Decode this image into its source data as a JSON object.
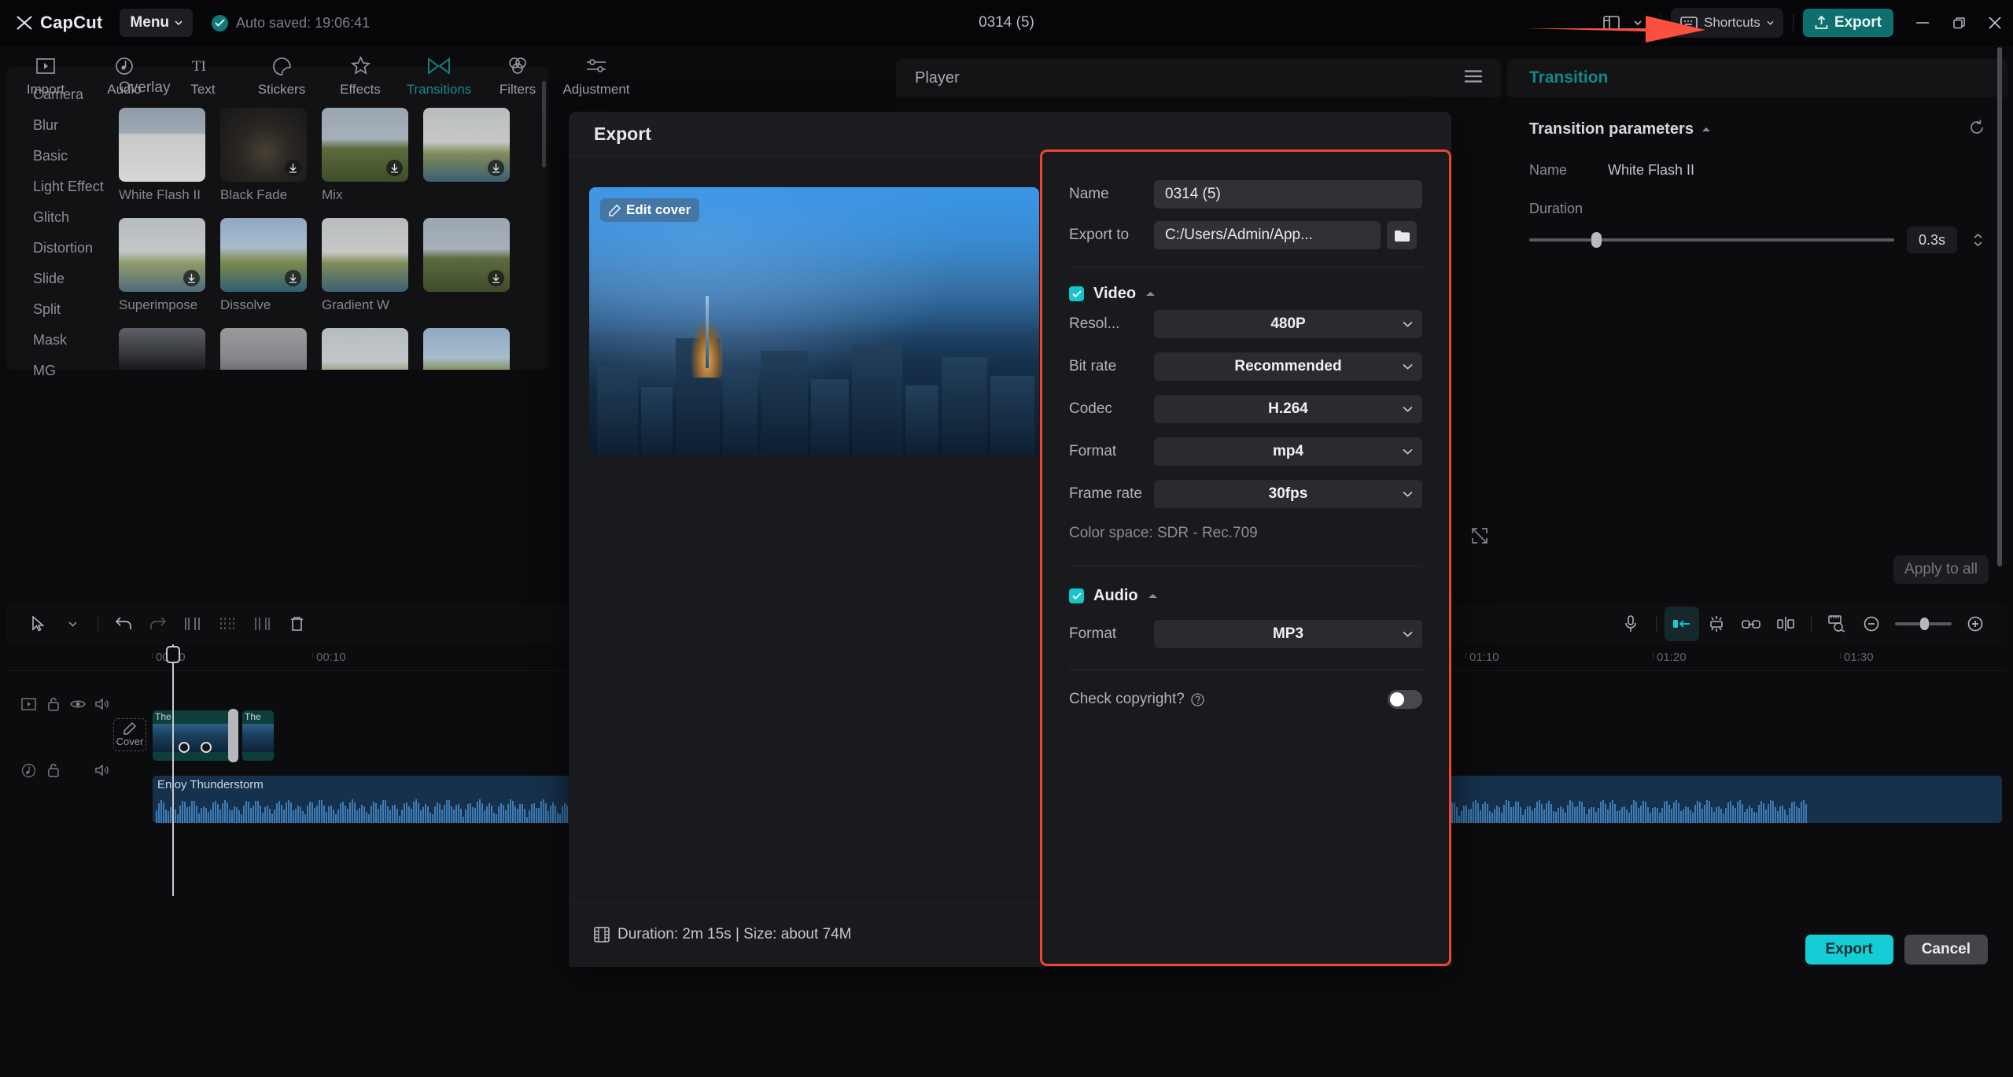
{
  "app": {
    "brand": "CapCut",
    "menu_label": "Menu",
    "autosave_text": "Auto saved: 19:06:41",
    "project_title": "0314 (5)",
    "shortcuts_label": "Shortcuts",
    "export_label": "Export",
    "accent_teal": "#16898a",
    "accent_cyan": "#15cdd4",
    "highlight_red": "#f04432"
  },
  "tabs": [
    {
      "label": "Import",
      "icon": "import-icon",
      "active": false
    },
    {
      "label": "Audio",
      "icon": "audio-icon",
      "active": false
    },
    {
      "label": "Text",
      "icon": "text-icon",
      "active": false
    },
    {
      "label": "Stickers",
      "icon": "stickers-icon",
      "active": false
    },
    {
      "label": "Effects",
      "icon": "effects-icon",
      "active": false
    },
    {
      "label": "Transitions",
      "icon": "transitions-icon",
      "active": true
    },
    {
      "label": "Filters",
      "icon": "filters-icon",
      "active": false
    },
    {
      "label": "Adjustment",
      "icon": "adjustment-icon",
      "active": false
    }
  ],
  "categories": [
    "Camera",
    "Blur",
    "Basic",
    "Light Effect",
    "Glitch",
    "Distortion",
    "Slide",
    "Split",
    "Mask",
    "MG"
  ],
  "transitions": {
    "group_title": "Overlay",
    "items": [
      {
        "name": "White Flash II",
        "art": "art-wf",
        "download": false
      },
      {
        "name": "Black Fade",
        "art": "art-bf",
        "download": true
      },
      {
        "name": "Mix",
        "art": "art-mix",
        "download": true
      },
      {
        "name": "",
        "art": "art-gw",
        "download": true
      },
      {
        "name": "Superimpose",
        "art": "art-sup",
        "download": true
      },
      {
        "name": "Dissolve",
        "art": "art-dis",
        "download": true
      },
      {
        "name": "Gradient W",
        "art": "art-gw",
        "download": false
      },
      {
        "name": "",
        "art": "art-mix",
        "download": true
      },
      {
        "name": "",
        "art": "art-r3a",
        "download": true
      },
      {
        "name": "",
        "art": "art-r3b",
        "download": false
      },
      {
        "name": "",
        "art": "art-sup",
        "download": false
      },
      {
        "name": "",
        "art": "art-dis",
        "download": false
      }
    ]
  },
  "player": {
    "title": "Player",
    "menu_icon": "hamburger-icon",
    "expand_icon": "expand-icon"
  },
  "right_panel": {
    "title": "Transition",
    "section_title": "Transition parameters",
    "reset_icon": "reset-icon",
    "name_label": "Name",
    "name_value": "White Flash II",
    "duration_label": "Duration",
    "duration_value": "0.3s",
    "duration_slider_pct": 17,
    "apply_all_label": "Apply to all"
  },
  "timeline": {
    "tool_icons": [
      "select-arrow-icon",
      "chevron-down-icon",
      "undo-icon",
      "redo-icon",
      "split-left-icon",
      "split-icon",
      "split-right-icon",
      "delete-icon"
    ],
    "right_icons": [
      "mic-icon",
      "auto-fit-icon",
      "snap-icon",
      "link-icon",
      "keyframe-icon",
      "ruler-icon",
      "zoom-out-icon",
      "zoom-in-icon"
    ],
    "ruler_labels": [
      "00:00",
      "00:10",
      "01:10",
      "01:20",
      "01:30"
    ],
    "video_track_icons": [
      "video-icon",
      "lock-icon",
      "eye-icon",
      "speaker-icon"
    ],
    "audio_track_icons": [
      "audio-note-icon",
      "lock-icon",
      "speaker-icon"
    ],
    "cover_label": "Cover",
    "video_clip_label": "The",
    "video_clip_label_2": "The",
    "audio_clip_label": "Enjoy Thunderstorm"
  },
  "export_dialog": {
    "title": "Export",
    "edit_cover_label": "Edit cover",
    "name_label": "Name",
    "name_value": "0314 (5)",
    "export_to_label": "Export to",
    "export_to_value": "C:/Users/Admin/App...",
    "folder_icon": "folder-icon",
    "video_section": {
      "label": "Video",
      "checked": true,
      "rows": [
        {
          "label": "Resol...",
          "value": "480P"
        },
        {
          "label": "Bit rate",
          "value": "Recommended"
        },
        {
          "label": "Codec",
          "value": "H.264"
        },
        {
          "label": "Format",
          "value": "mp4"
        },
        {
          "label": "Frame rate",
          "value": "30fps"
        }
      ],
      "color_space": "Color space: SDR - Rec.709"
    },
    "audio_section": {
      "label": "Audio",
      "checked": true,
      "rows": [
        {
          "label": "Format",
          "value": "MP3"
        }
      ]
    },
    "copyright": {
      "label": "Check copyright?",
      "help_icon": "question-icon",
      "enabled": false
    },
    "footer": {
      "film_icon": "film-icon",
      "duration_size": "Duration: 2m 15s | Size: about 74M",
      "export_label": "Export",
      "cancel_label": "Cancel"
    }
  }
}
